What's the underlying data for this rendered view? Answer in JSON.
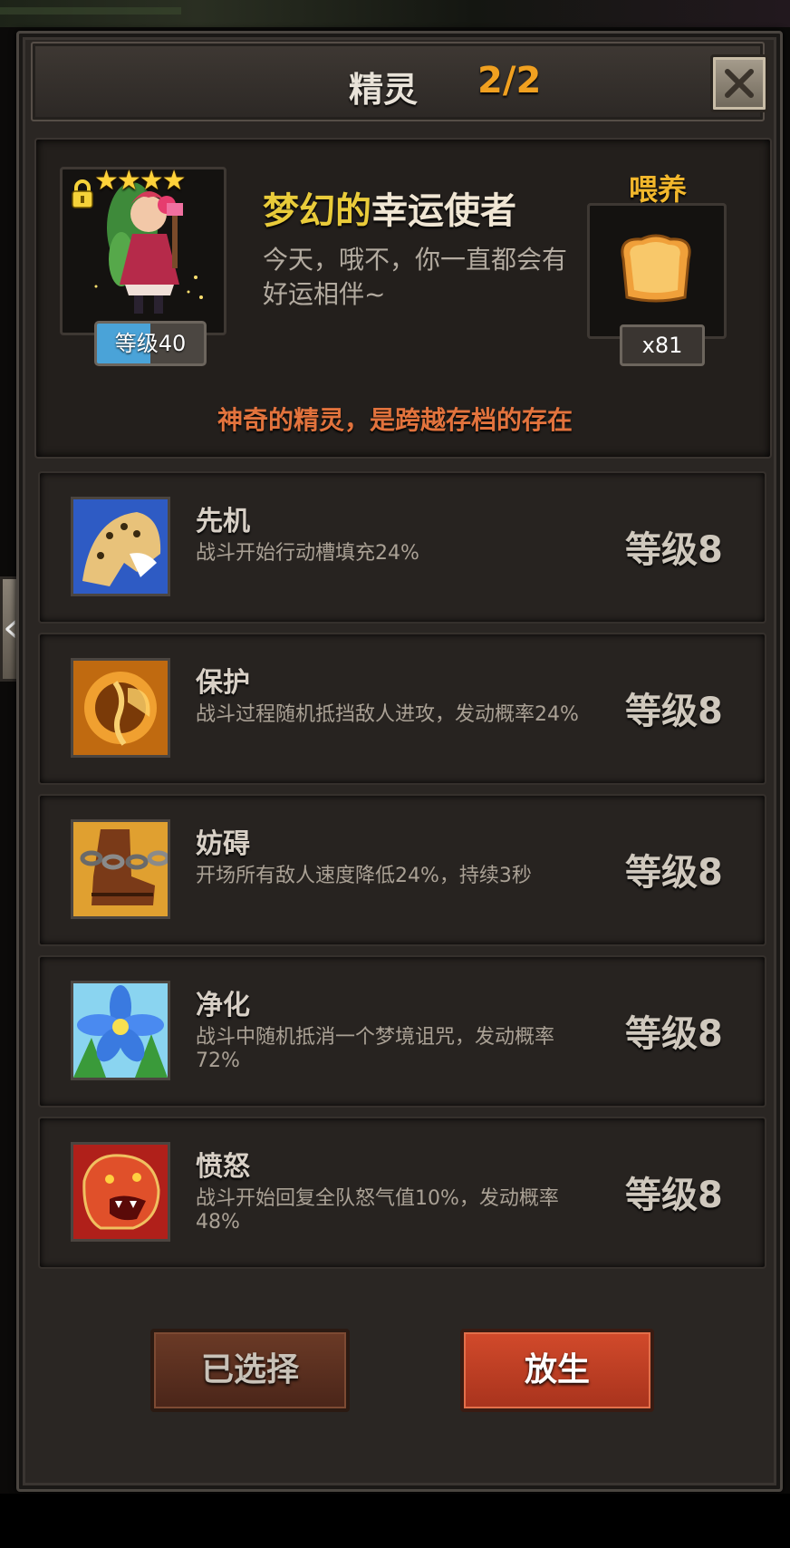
{
  "header": {
    "title": "精灵",
    "count": "2/2"
  },
  "pet": {
    "stars": "★★★★",
    "level_label": "等级40",
    "name_highlight": "梦幻的",
    "name_rest": "幸运使者",
    "description": "今天，哦不，你一直都会有好运相伴~",
    "tagline": "神奇的精灵，是跨越存档的存在"
  },
  "feed": {
    "label": "喂养",
    "count": "x81",
    "icon": "bread-icon"
  },
  "skills": [
    {
      "name": "先机",
      "desc": "战斗开始行动槽填充24%",
      "level": "等级8",
      "icon": "leopard-icon"
    },
    {
      "name": "保护",
      "desc": "战斗过程随机抵挡敌人进攻，发动概率24%",
      "level": "等级8",
      "icon": "fairy-shield-icon"
    },
    {
      "name": "妨碍",
      "desc": "开场所有敌人速度降低24%，持续3秒",
      "level": "等级8",
      "icon": "chained-boot-icon"
    },
    {
      "name": "净化",
      "desc": "战斗中随机抵消一个梦境诅咒，发动概率72%",
      "level": "等级8",
      "icon": "blue-flower-icon"
    },
    {
      "name": "愤怒",
      "desc": "战斗开始回复全队怒气值10%，发动概率48%",
      "level": "等级8",
      "icon": "roaring-beast-icon"
    }
  ],
  "buttons": {
    "selected": "已选择",
    "release": "放生"
  },
  "colors": {
    "accent": "#f0a020",
    "name_highlight": "#e9cb3a",
    "tagline": "#e2733d",
    "release_button": "#c2412a"
  }
}
